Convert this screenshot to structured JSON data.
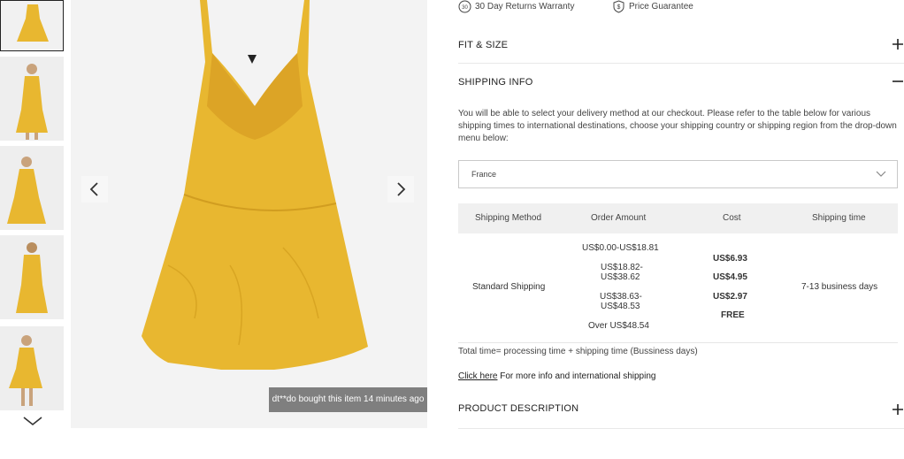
{
  "gallery": {
    "thumbnails": [
      {
        "name": "thumbnail-1"
      },
      {
        "name": "thumbnail-2"
      },
      {
        "name": "thumbnail-3"
      },
      {
        "name": "thumbnail-4"
      },
      {
        "name": "thumbnail-5"
      }
    ],
    "recent_purchase": "dt**do bought this item 14 minutes ago",
    "product_color": "#e8b730"
  },
  "badges": {
    "returns": "30 Day Returns Warranty",
    "returns_icon_text": "30",
    "price": "Price Guarantee",
    "price_icon_text": "$"
  },
  "accordion": {
    "fit_size": "FIT & SIZE",
    "shipping_info": "SHIPPING INFO",
    "product_description": "PRODUCT DESCRIPTION"
  },
  "shipping": {
    "description": "You will be able to select your delivery method at our checkout. Please refer to the table below for various shipping times to international destinations, choose your shipping country or shipping region from the drop-down menu below:",
    "country": "France",
    "headers": {
      "method": "Shipping Method",
      "amount": "Order Amount",
      "cost": "Cost",
      "time": "Shipping time"
    },
    "method": "Standard Shipping",
    "amounts": {
      "a1": "US$0.00-US$18.81",
      "a2_line1": "US$18.82-",
      "a2_line2": "US$38.62",
      "a3_line1": "US$38.63-",
      "a3_line2": "US$48.53",
      "a4": "Over US$48.54"
    },
    "costs": [
      "US$6.93",
      "US$4.95",
      "US$2.97",
      "FREE"
    ],
    "time": "7-13 business days",
    "total_note": "Total time= processing time + shipping time (Bussiness days)",
    "link_text": "Click here",
    "link_suffix": " For more info and international shipping"
  }
}
